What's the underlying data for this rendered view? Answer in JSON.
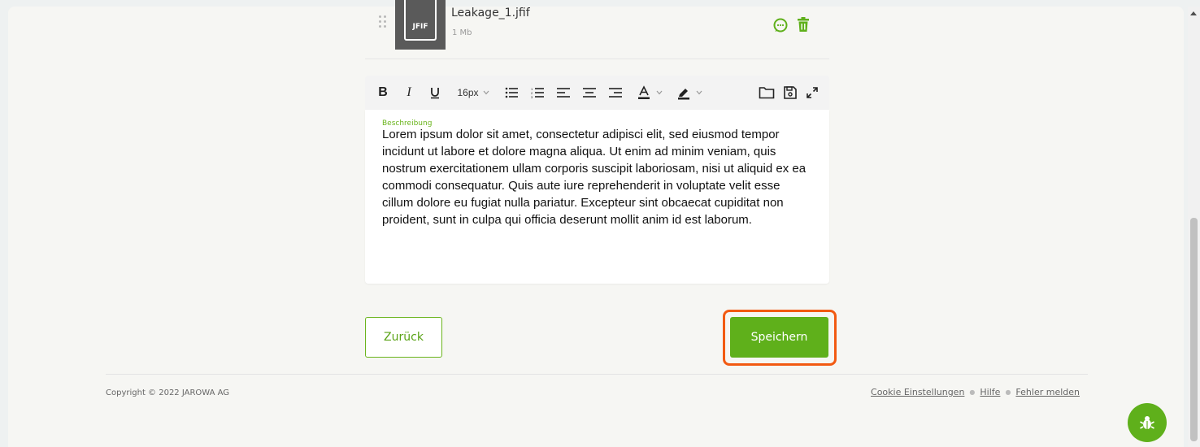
{
  "attachment": {
    "file_type_badge": "JFIF",
    "file_name": "Leakage_1.jfif",
    "file_size": "1 Mb",
    "icons": [
      "drag-handle-icon",
      "comment-icon",
      "trash-icon",
      "file-icon"
    ]
  },
  "toolbar": {
    "font_size": "16px",
    "buttons": [
      "bold",
      "italic",
      "underline",
      "font-size",
      "bullet-list",
      "numbered-list",
      "align-left",
      "align-center",
      "align-right",
      "text-color",
      "highlight-color",
      "folder",
      "save",
      "fullscreen"
    ]
  },
  "editor": {
    "label": "Beschreibung",
    "text": "Lorem ipsum dolor sit amet, consectetur adipisci elit, sed eiusmod tempor incidunt ut labore et dolore magna aliqua. Ut enim ad minim veniam, quis nostrum exercitationem ullam corporis suscipit laboriosam, nisi ut aliquid ex ea commodi consequatur. Quis aute iure reprehenderit in voluptate velit esse cillum dolore eu fugiat nulla pariatur. Excepteur sint obcaecat cupiditat non proident, sunt in culpa qui officia deserunt mollit anim id est laborum."
  },
  "actions": {
    "back_label": "Zurück",
    "save_label": "Speichern"
  },
  "footer": {
    "copyright": "Copyright © 2022 JAROWA AG",
    "links": [
      "Cookie Einstellungen",
      "Hilfe",
      "Fehler melden"
    ]
  },
  "colors": {
    "accent": "#5fb01b",
    "highlight": "#f25a12",
    "page_background": "#f6f6f3"
  }
}
